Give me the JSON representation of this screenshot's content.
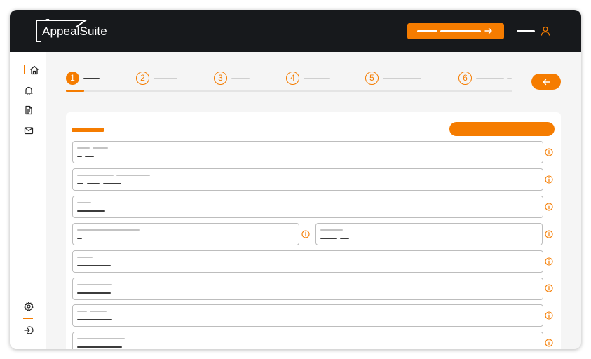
{
  "app": {
    "name": "AppealSuite"
  },
  "colors": {
    "accent": "#f57c00",
    "header_bg": "#17191c",
    "sidebar_bg": "#ffffff",
    "content_bg": "#f5f5f5",
    "field_border": "#bdbdbd"
  },
  "header": {
    "cta_icon": "arrow-right-icon",
    "user_icon": "user-icon"
  },
  "sidebar": {
    "items": [
      {
        "icon": "home-icon",
        "active": true
      },
      {
        "icon": "bell-icon",
        "active": false
      },
      {
        "icon": "document-icon",
        "active": false
      },
      {
        "icon": "mail-icon",
        "active": false
      }
    ],
    "bottom_items": [
      {
        "icon": "gear-icon"
      },
      {
        "icon": "logout-icon"
      }
    ]
  },
  "stepper": {
    "steps": [
      {
        "number": "1",
        "active": true
      },
      {
        "number": "2",
        "active": false
      },
      {
        "number": "3",
        "active": false
      },
      {
        "number": "4",
        "active": false
      },
      {
        "number": "5",
        "active": false
      },
      {
        "number": "6",
        "active": false
      }
    ],
    "back_icon": "arrow-left-icon"
  },
  "form": {
    "field_count": 8,
    "info_icon": "info-icon"
  }
}
